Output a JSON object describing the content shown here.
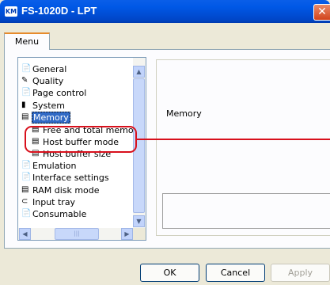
{
  "window": {
    "title": "FS-1020D - LPT",
    "close_glyph": "✕"
  },
  "tabs": [
    {
      "label": "Menu"
    }
  ],
  "tree": {
    "items": [
      {
        "label": "General",
        "icon": "page-icon",
        "level": 0
      },
      {
        "label": "Quality",
        "icon": "pen-icon",
        "level": 0
      },
      {
        "label": "Page control",
        "icon": "page-icon",
        "level": 0
      },
      {
        "label": "System",
        "icon": "computer-icon",
        "level": 0
      },
      {
        "label": "Memory",
        "icon": "memory-icon",
        "level": 0,
        "selected": true
      },
      {
        "label": "Free and total memory",
        "icon": "memory-chip-icon",
        "level": 1
      },
      {
        "label": "Host buffer mode",
        "icon": "memory-chip-icon",
        "level": 1
      },
      {
        "label": "Host buffer size",
        "icon": "memory-chip-icon",
        "level": 1
      },
      {
        "label": "Emulation",
        "icon": "page-icon",
        "level": 0
      },
      {
        "label": "Interface settings",
        "icon": "page-icon",
        "level": 0
      },
      {
        "label": "RAM disk mode",
        "icon": "memory-icon",
        "level": 0
      },
      {
        "label": "Input tray",
        "icon": "tray-icon",
        "level": 0
      },
      {
        "label": "Consumable",
        "icon": "page-icon",
        "level": 0
      }
    ]
  },
  "detail": {
    "title": "Memory"
  },
  "buttons": {
    "ok": "OK",
    "cancel": "Cancel",
    "apply": "Apply"
  },
  "colors": {
    "title_bar": "#0058e6",
    "selection": "#316ac5",
    "callout": "#d8101c"
  }
}
